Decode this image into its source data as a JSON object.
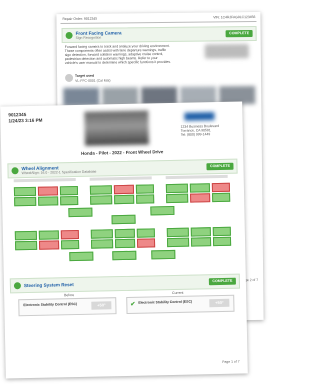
{
  "back_page": {
    "header_left": "Repair Order: 9012345",
    "header_right": "VIN: 1C4RJFAG9LC123456",
    "section_title": "Front Facing Camera",
    "section_subtitle": "Sign Recognition",
    "section_button": "COMPLETE",
    "body_text": [
      "Forward facing camera to track and analyze your driving environment.",
      "These components often assist with lane departure warnings, traffic",
      "sign detection, forward collision warnings, adaptive cruise control,",
      "pedestrian detection and automatic high beams. Refer to your",
      "vehicle's user manual to determine which specific functions it provides."
    ],
    "tech_label": "Target used",
    "tech_sub": "VL-FFC-0001 (Cal Mat)",
    "page_label": "Page 2 of 7"
  },
  "front_page": {
    "ro_number": "9012345",
    "date": "1/24/23 3:16 PM",
    "vehicle_line": "Honda - Pilot - 2022 - Front Wheel Drive",
    "shop_address": [
      "1234 Business Boulevard",
      "Torrance, CA 90501",
      "Tel: (800) 999-1449"
    ],
    "wheel_section": {
      "title": "Wheel Alignment",
      "subtitle": "WheelAlign: 16.0 - 2022-1 Specification Database",
      "button": "COMPLETE"
    },
    "steering_section": {
      "title": "Steering System Reset",
      "button": "COMPLETE",
      "before_label": "Before",
      "current_label": "Current",
      "before_item": "Electronic Stability Control (ESC)",
      "current_item": "Electronic Stability Control (ESC)",
      "before_badge": "+50°",
      "current_badge": "+50°"
    },
    "page_label": "Page 1 of 7"
  },
  "colors": {
    "accent_green": "#4aa83f",
    "header_blue": "#1f5fa8"
  },
  "icons": [
    "car-icon",
    "steering-wheel-icon",
    "check-icon"
  ]
}
